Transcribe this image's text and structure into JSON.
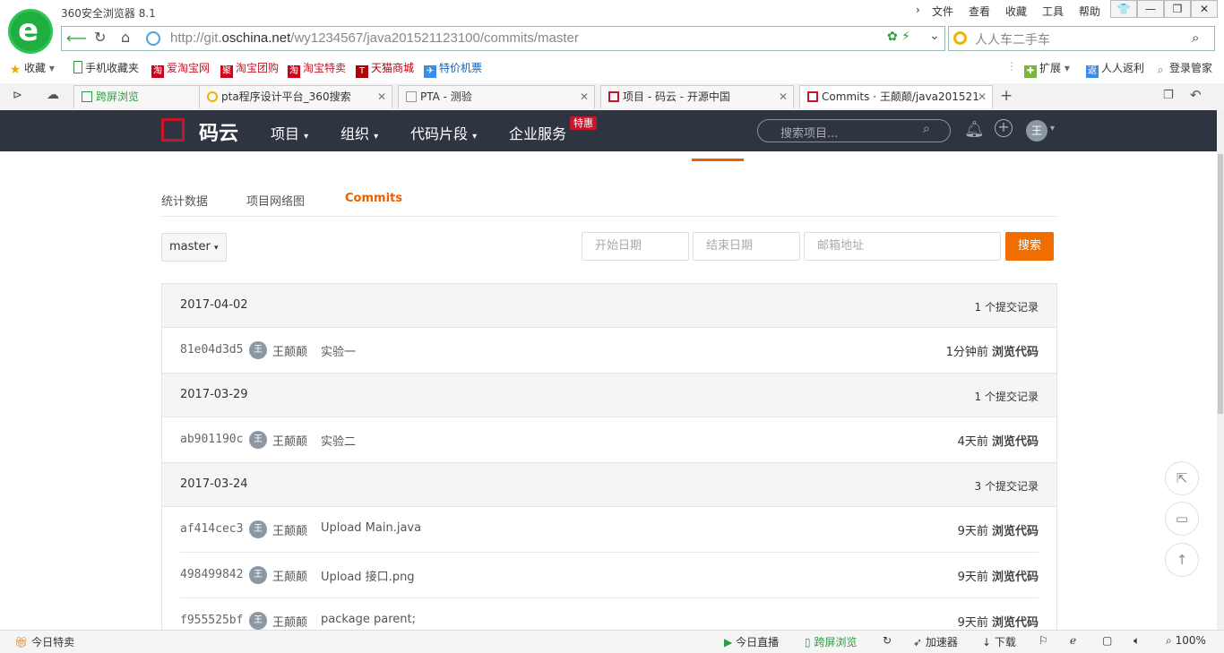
{
  "browser": {
    "app_title": "360安全浏览器 8.1",
    "menu": [
      "文件",
      "查看",
      "收藏",
      "工具",
      "帮助"
    ],
    "window_buttons": [
      "👕",
      "—",
      "❐",
      "✕"
    ],
    "url_prefix": "http://git.",
    "url_domain": "oschina.net",
    "url_path": "/wy1234567/java201521123100/commits/master",
    "search_placeholder": "人人车二手车",
    "favorites": [
      {
        "label": "收藏",
        "icon": "star-icon"
      },
      {
        "label": "手机收藏夹",
        "icon": "phone-icon"
      },
      {
        "label": "爱淘宝网",
        "icon": "taobao-icon"
      },
      {
        "label": "淘宝团购",
        "icon": "juhuasuan-icon"
      },
      {
        "label": "淘宝特卖",
        "icon": "taobao-icon"
      },
      {
        "label": "天猫商城",
        "icon": "tmall-icon"
      },
      {
        "label": "特价机票",
        "icon": "plane-icon"
      }
    ],
    "fav_right": [
      "扩展",
      "人人返利",
      "登录管家"
    ],
    "tabs": [
      {
        "label": "跨屏浏览"
      },
      {
        "label": "pta程序设计平台_360搜索"
      },
      {
        "label": "PTA - 测验"
      },
      {
        "label": "项目 - 码云 - 开源中国"
      },
      {
        "label": "Commits · 王颠颠/java201521"
      }
    ],
    "status": {
      "left": "今日特卖",
      "items": [
        "今日直播",
        "跨屏浏览",
        "加速器",
        "下载"
      ],
      "zoom": "100%"
    }
  },
  "site": {
    "name": "码云",
    "nav": [
      "项目",
      "组织",
      "代码片段",
      "企业服务"
    ],
    "badge": "特惠",
    "search_placeholder": "搜索项目...",
    "avatar_text": "王"
  },
  "subtabs": [
    "统计数据",
    "项目网络图",
    "Commits"
  ],
  "filter": {
    "branch": "master",
    "start_placeholder": "开始日期",
    "end_placeholder": "结束日期",
    "email_placeholder": "邮箱地址",
    "search_label": "搜索"
  },
  "commit_groups": [
    {
      "date": "2017-04-02",
      "count": "1 个提交记录",
      "commits": [
        {
          "sha": "81e04d3d5",
          "author": "王颠颠",
          "message": "实验一",
          "time": "1分钟前",
          "action": "浏览代码"
        }
      ]
    },
    {
      "date": "2017-03-29",
      "count": "1 个提交记录",
      "commits": [
        {
          "sha": "ab901190c",
          "author": "王颠颠",
          "message": "实验二",
          "time": "4天前",
          "action": "浏览代码"
        }
      ]
    },
    {
      "date": "2017-03-24",
      "count": "3 个提交记录",
      "commits": [
        {
          "sha": "af414cec3",
          "author": "王颠颠",
          "message": "Upload Main.java",
          "time": "9天前",
          "action": "浏览代码"
        },
        {
          "sha": "498499842",
          "author": "王颠颠",
          "message": "Upload 接口.png",
          "time": "9天前",
          "action": "浏览代码"
        },
        {
          "sha": "f955525bf",
          "author": "王颠颠",
          "message": "package parent;",
          "time": "9天前",
          "action": "浏览代码"
        }
      ]
    }
  ],
  "avatar_char": "王",
  "colors": {
    "accent": "#f26d00",
    "header": "#2e3440",
    "brand_red": "#c7162b"
  }
}
